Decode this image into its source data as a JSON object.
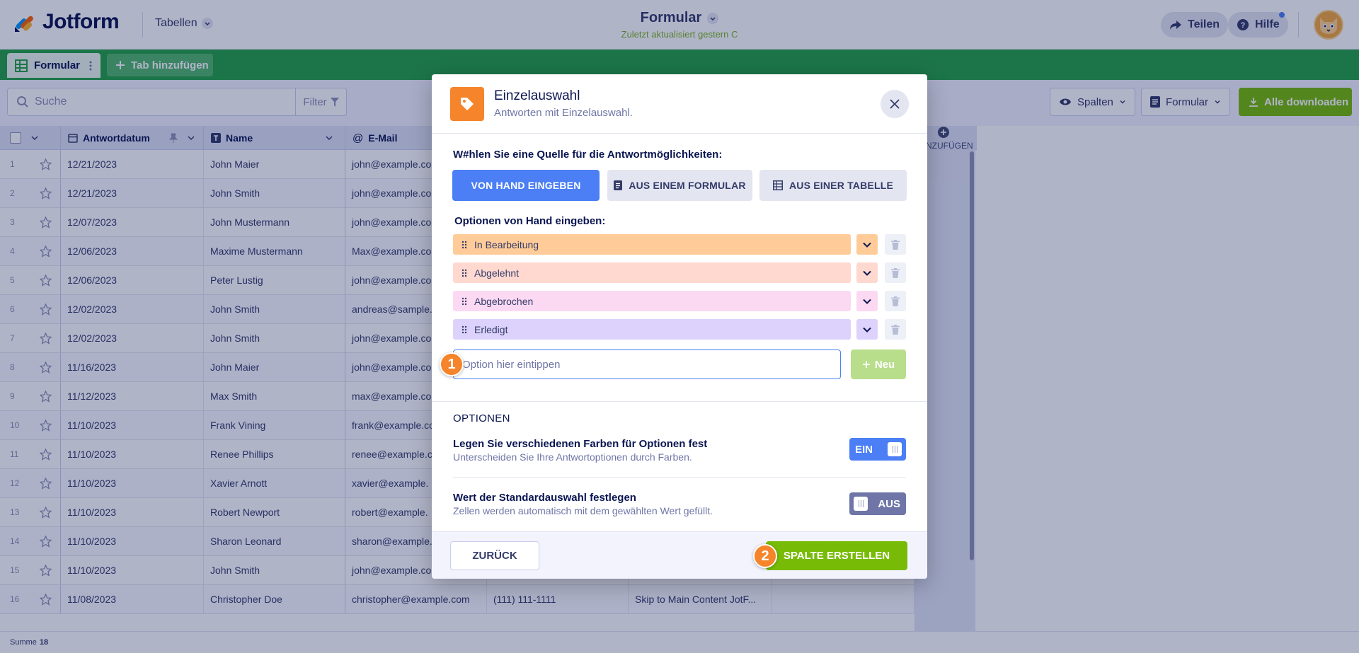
{
  "header": {
    "logo_text": "Jotform",
    "tables_menu": "Tabellen",
    "title": "Formular",
    "subtitle": "Zuletzt aktualisiert gestern C",
    "share": "Teilen",
    "help": "Hilfe"
  },
  "tabs": {
    "active": "Formular",
    "add": "Tab hinzufügen"
  },
  "toolbar": {
    "search_placeholder": "Suche",
    "filter": "Filter",
    "columns": "Spalten",
    "form": "Formular",
    "download": "Alle downloaden"
  },
  "grid": {
    "headers": {
      "date": "Antwortdatum",
      "name": "Name",
      "email": "E-Mail",
      "add_col": "NZUFÜGEN"
    },
    "rows": [
      {
        "n": "1",
        "date": "12/21/2023",
        "name": "John Maier",
        "email": "john@example.co"
      },
      {
        "n": "2",
        "date": "12/21/2023",
        "name": "John Smith",
        "email": "john@example.co"
      },
      {
        "n": "3",
        "date": "12/07/2023",
        "name": "John Mustermann",
        "email": "john@example.co"
      },
      {
        "n": "4",
        "date": "12/06/2023",
        "name": "Maxime Mustermann",
        "email": "Max@example.co"
      },
      {
        "n": "5",
        "date": "12/06/2023",
        "name": "Peter Lustig",
        "email": "john@example.co"
      },
      {
        "n": "6",
        "date": "12/02/2023",
        "name": "John Smith",
        "email": "andreas@sample."
      },
      {
        "n": "7",
        "date": "12/02/2023",
        "name": "John Smith",
        "email": "john@example.co"
      },
      {
        "n": "8",
        "date": "11/16/2023",
        "name": "John Maier",
        "email": "john@example.co"
      },
      {
        "n": "9",
        "date": "11/12/2023",
        "name": "Max Smith",
        "email": "max@example.co"
      },
      {
        "n": "10",
        "date": "11/10/2023",
        "name": "Frank Vining",
        "email": "frank@example.co"
      },
      {
        "n": "11",
        "date": "11/10/2023",
        "name": "Renee Phillips",
        "email": "renee@example.c"
      },
      {
        "n": "12",
        "date": "11/10/2023",
        "name": "Xavier Arnott",
        "email": "xavier@example."
      },
      {
        "n": "13",
        "date": "11/10/2023",
        "name": "Robert Newport",
        "email": "robert@example."
      },
      {
        "n": "14",
        "date": "11/10/2023",
        "name": "Sharon Leonard",
        "email": "sharon@example."
      },
      {
        "n": "15",
        "date": "11/10/2023",
        "name": "John Smith",
        "email": "john@example.co"
      },
      {
        "n": "16",
        "date": "11/08/2023",
        "name": "Christopher Doe",
        "email": "christopher@example.com",
        "phone": "(111) 111-1111",
        "text": "Skip to Main Content JotF..."
      }
    ],
    "footer_label": "Summe",
    "footer_count": "18"
  },
  "modal": {
    "title": "Einzelauswahl",
    "subtitle": "Antworten mit Einzelauswahl.",
    "source_label": "W#hlen Sie eine Quelle für die Antwortmöglichkeiten:",
    "src_manual": "VON HAND EINGEBEN",
    "src_form": "AUS EINEM FORMULAR",
    "src_table": "AUS EINER TABELLE",
    "options_label": "Optionen von Hand eingeben:",
    "options": [
      {
        "label": "In Bearbeitung",
        "color": "#ffcc99",
        "dd_color": "#ffcc99"
      },
      {
        "label": "Abgelehnt",
        "color": "#ffd8cf",
        "dd_color": "#ffd8cf"
      },
      {
        "label": "Abgebrochen",
        "color": "#fcd9f2",
        "dd_color": "#fcd9f2"
      },
      {
        "label": "Erledigt",
        "color": "#dcd2fc",
        "dd_color": "#dcd2fc"
      }
    ],
    "new_option_placeholder": "Option hier eintippen",
    "new_button": "Neu",
    "section_title": "OPTIONEN",
    "setting1_title": "Legen Sie verschiedenen Farben für Optionen fest",
    "setting1_sub": "Unterscheiden Sie Ihre Antwortoptionen durch Farben.",
    "setting1_state": "EIN",
    "setting2_title": "Wert der Standardauswahl festlegen",
    "setting2_sub": "Zellen werden automatisch mit dem gewählten Wert gefüllt.",
    "setting2_state": "AUS",
    "back": "ZURÜCK",
    "create": "SPALTE ERSTELLEN"
  },
  "badges": {
    "one": "1",
    "two": "2"
  },
  "colors": {
    "brand_green": "#25a244",
    "primary_blue": "#4c7ff5",
    "action_green": "#78bb07",
    "accent_orange": "#f5842a"
  }
}
